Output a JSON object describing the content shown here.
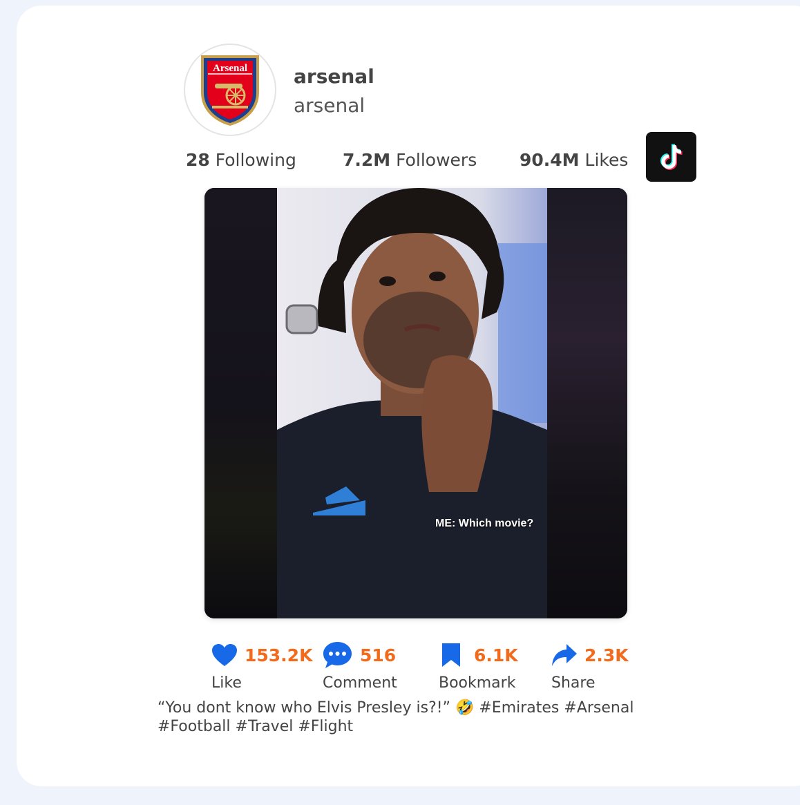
{
  "profile": {
    "display_name": "arsenal",
    "username": "arsenal",
    "avatar_icon": "arsenal-crest-logo",
    "logo_text": "Arsenal"
  },
  "stats": {
    "following_count": "28",
    "following_label": "Following",
    "followers_count": "7.2M",
    "followers_label": "Followers",
    "likes_count": "90.4M",
    "likes_label": "Likes"
  },
  "platform_icon": "tiktok-logo-icon",
  "video": {
    "overlay_caption": "ME: Which movie?"
  },
  "actions": {
    "like": {
      "count": "153.2K",
      "label": "Like",
      "icon": "heart-icon",
      "color": "#1769e8"
    },
    "comment": {
      "count": "516",
      "label": "Comment",
      "icon": "comment-bubble-icon",
      "color": "#1769e8"
    },
    "bookmark": {
      "count": "6.1K",
      "label": "Bookmark",
      "icon": "bookmark-icon",
      "color": "#1769e8"
    },
    "share": {
      "count": "2.3K",
      "label": "Share",
      "icon": "share-arrow-icon",
      "color": "#1769e8"
    }
  },
  "accent_color": "#f26a1b",
  "description_line1": "“You dont know who Elvis Presley is?!” 🤣 #Emirates #Arsenal",
  "description_line2": "#Football #Travel #Flight"
}
